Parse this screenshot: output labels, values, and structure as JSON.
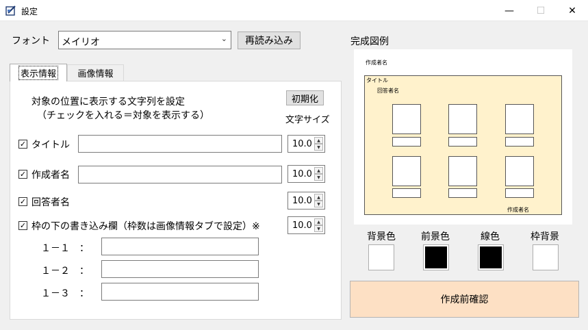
{
  "window": {
    "title": "設定",
    "minimize_glyph": "—",
    "maximize_glyph": "☐",
    "close_glyph": "✕"
  },
  "font": {
    "label": "フォント",
    "selected": "メイリオ",
    "reload_button": "再読み込み"
  },
  "tabs": [
    {
      "label": "表示情報",
      "active": true
    },
    {
      "label": "画像情報",
      "active": false
    }
  ],
  "display": {
    "description_line1": "対象の位置に表示する文字列を設定",
    "description_line2": "（チェックを入れる＝対象を表示する）",
    "reset_button": "初期化",
    "font_size_header": "文字サイズ",
    "rows": [
      {
        "label": "タイトル",
        "checked": true,
        "value": "",
        "size": "10.0"
      },
      {
        "label": "作成者名",
        "checked": true,
        "value": "",
        "size": "10.0"
      },
      {
        "label": "回答者名",
        "checked": true,
        "size": "10.0"
      },
      {
        "label": "枠の下の書き込み欄（枠数は画像情報タブで設定）※",
        "checked": true,
        "size": "10.0"
      }
    ],
    "sub_fields": [
      {
        "label": "１－１　：",
        "value": ""
      },
      {
        "label": "１－２　：",
        "value": ""
      },
      {
        "label": "１－３　：",
        "value": ""
      }
    ]
  },
  "preview": {
    "heading": "完成図例",
    "author_top": "作成者名",
    "title": "タイトル",
    "respondent": "回答者名",
    "author_bottom": "作成者名",
    "frame_color": "#fff2cc"
  },
  "colors": [
    {
      "label": "背景色",
      "value": "#ffffff"
    },
    {
      "label": "前景色",
      "value": "#000000"
    },
    {
      "label": "線色",
      "value": "#000000"
    },
    {
      "label": "枠背景",
      "value": "#ffffff"
    }
  ],
  "confirm_button": "作成前確認"
}
